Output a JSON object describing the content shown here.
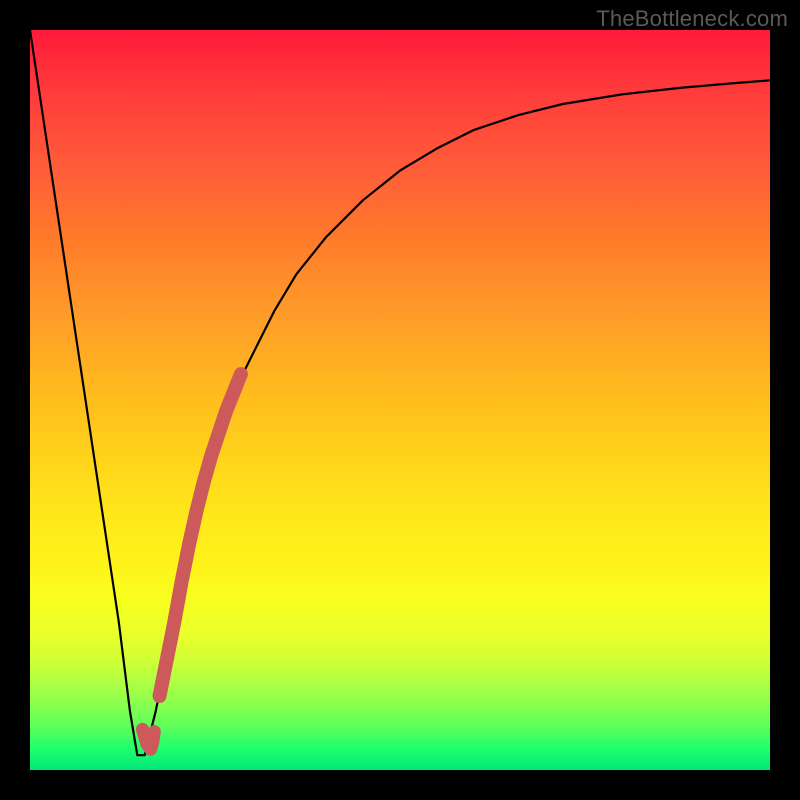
{
  "watermark": "TheBottleneck.com",
  "colors": {
    "curve": "#000000",
    "marker": "#cc5a5a",
    "gradient_top": "#ff1a3a",
    "gradient_bottom": "#00e87a"
  },
  "chart_data": {
    "type": "line",
    "title": "",
    "xlabel": "",
    "ylabel": "",
    "xlim": [
      0,
      100
    ],
    "ylim": [
      0,
      100
    ],
    "series": [
      {
        "name": "bottleneck-curve",
        "x": [
          0,
          3,
          6,
          9,
          12,
          13.5,
          14.5,
          15.5,
          17,
          19,
          21,
          23,
          25,
          27,
          29,
          31,
          33,
          36,
          40,
          45,
          50,
          55,
          60,
          66,
          72,
          80,
          88,
          95,
          100
        ],
        "y": [
          100,
          80,
          60,
          40,
          20,
          8,
          2,
          2,
          8,
          18,
          28,
          36,
          43,
          49,
          54,
          58,
          62,
          67,
          72,
          77,
          81,
          84,
          86.5,
          88.5,
          90,
          91.3,
          92.2,
          92.8,
          93.2
        ]
      }
    ],
    "markers": [
      {
        "name": "highlight-segment",
        "x": [
          17.5,
          18.5,
          19.5,
          20.5,
          21.5,
          22.5,
          23.5,
          24.5,
          25.5,
          26.5,
          27.5,
          28.5
        ],
        "y": [
          10,
          15,
          20,
          25.5,
          30.5,
          35,
          39,
          42.5,
          45.5,
          48.5,
          51,
          53.5
        ]
      },
      {
        "name": "bottom-j-marker",
        "x": [
          15.2,
          15.8,
          16.3,
          16.6,
          16.8
        ],
        "y": [
          5.5,
          3.5,
          2.8,
          3.8,
          5.2
        ]
      }
    ]
  }
}
